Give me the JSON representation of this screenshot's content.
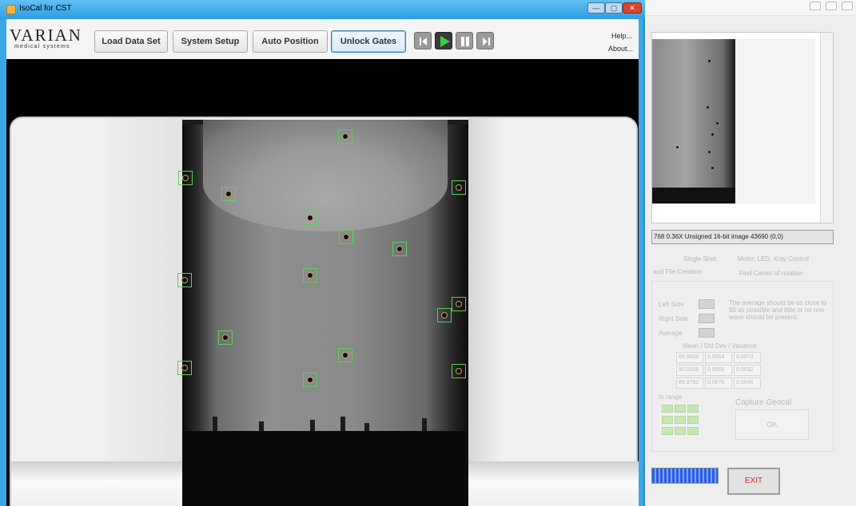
{
  "app": {
    "title": "IsoCal for CST",
    "window_controls": {
      "minimize": "—",
      "maximize": "▢",
      "close": "✕"
    }
  },
  "logo": {
    "word": "VARIAN",
    "sub": "medical systems"
  },
  "toolbar": {
    "load_label": "Load Data Set",
    "setup_label": "System Setup",
    "auto_label": "Auto Position",
    "unlock_label": "Unlock Gates",
    "media_icons": [
      "step-back-icon",
      "play-icon",
      "pause-icon",
      "step-forward-icon"
    ],
    "help_label": "Help...",
    "about_label": "About..."
  },
  "viewer": {
    "markers_count_shown": 18
  },
  "background_window": {
    "status_text": "768 0.36X Unsigned 16-bit image 43690   (0,0)",
    "tabs": [
      "Single Shot",
      "Motor, LED, Xray Control",
      "and File Creation",
      "Find Center of rotation"
    ],
    "left_side": "Left Side",
    "right_side": "Right Side",
    "average": "Average",
    "note": "The average should be as close to 90 as possible and little or no one wave should be present.",
    "table_header": "Mean / Std Dev / Variance",
    "rows": [
      [
        "89.9508",
        "0.0854",
        "0.0073"
      ],
      [
        "90.0058",
        "0.0565",
        "0.0032"
      ],
      [
        "89.8782",
        "0.0676",
        "0.0046"
      ]
    ],
    "in_range": "In range",
    "capture_label": "Capture Geocal",
    "ok_label": "OK",
    "exit_label": "EXIT"
  },
  "colors": {
    "accent": "#3aa6e6",
    "marker": "#5bd05b",
    "exit_text": "#d03030"
  }
}
